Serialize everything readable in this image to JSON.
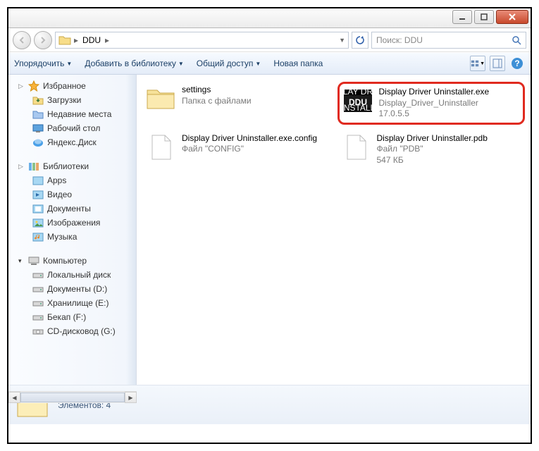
{
  "breadcrumb": {
    "folder": "DDU"
  },
  "search": {
    "placeholder": "Поиск: DDU"
  },
  "toolbar": {
    "organize": "Упорядочить",
    "addlib": "Добавить в библиотеку",
    "share": "Общий доступ",
    "newfolder": "Новая папка"
  },
  "sidebar": {
    "favorites": "Избранное",
    "downloads": "Загрузки",
    "recent": "Недавние места",
    "desktop": "Рабочий стол",
    "yandex": "Яндекс.Диск",
    "libraries": "Библиотеки",
    "apps": "Apps",
    "video": "Видео",
    "documents": "Документы",
    "images": "Изображения",
    "music": "Музыка",
    "computer": "Компьютер",
    "localdisk": "Локальный диск",
    "drive_d": "Документы (D:)",
    "drive_e": "Хранилище (E:)",
    "drive_f": "Бекап (F:)",
    "cdrom": "CD-дисковод (G:)"
  },
  "files": [
    {
      "name": "settings",
      "sub1": "Папка с файлами",
      "sub2": ""
    },
    {
      "name": "Display Driver Uninstaller.exe",
      "sub1": "Display_Driver_Uninstaller",
      "sub2": "17.0.5.5"
    },
    {
      "name": "Display Driver Uninstaller.exe.config",
      "sub1": "Файл \"CONFIG\"",
      "sub2": ""
    },
    {
      "name": "Display Driver Uninstaller.pdb",
      "sub1": "Файл \"PDB\"",
      "sub2": "547 КБ"
    }
  ],
  "status": {
    "count": "Элементов: 4"
  }
}
